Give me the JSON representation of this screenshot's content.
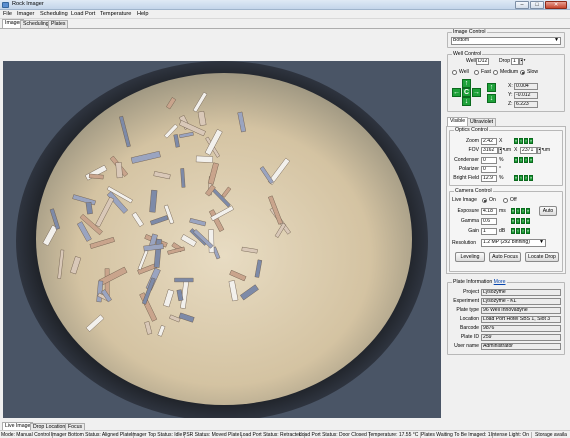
{
  "window": {
    "title": "Rock Imager",
    "minimize": "–",
    "maximize": "□",
    "close": "✕"
  },
  "menu": [
    "File",
    "Imager",
    "Scheduling",
    "Load Port",
    "Temperature",
    "Help"
  ],
  "tabs": [
    "Imager",
    "Scheduling",
    "Plates"
  ],
  "image_control": {
    "label": "Image Control",
    "value": "Bottom"
  },
  "well_control": {
    "label": "Well Control",
    "well_label": "Well",
    "well": "D12",
    "drop_label": "Drop",
    "drop": "1",
    "speeds": [
      "Well",
      "Fast",
      "Medium",
      "Slow"
    ],
    "selected_speed": "Slow",
    "x_label": "X:",
    "x": "0.004",
    "y_label": "Y:",
    "y": "-0.012",
    "z_label": "Z:",
    "z": "6.223",
    "center_label": "C"
  },
  "light_tabs": [
    "Visible",
    "Ultraviolet"
  ],
  "optics": {
    "label": "Optics Control",
    "zoom_label": "Zoom",
    "zoom": "2.42",
    "zoom_unit": "X",
    "fov_label": "FOV",
    "fov_w": "3162",
    "fov_h": "2371",
    "fov_unit": "um",
    "condenser_label": "Condenser",
    "condenser": "0",
    "pct": "%",
    "polarizer_label": "Polarizer",
    "polarizer": "0",
    "degree": "°",
    "bright_label": "Bright Field",
    "bright": "12.9"
  },
  "camera": {
    "label": "Camera Control",
    "live_label": "Live Image",
    "on": "On",
    "off": "Off",
    "exposure_label": "Exposure",
    "exposure": "4.18",
    "exposure_unit": "ms",
    "auto": "Auto",
    "gamma_label": "Gamma",
    "gamma": "0.6",
    "gain_label": "Gain",
    "gain": "1",
    "gain_unit": "dB",
    "resolution_label": "Resolution",
    "resolution": "1.2 MP (2x2 binning)",
    "leveling": "Leveling",
    "autofocus": "Auto Focus",
    "locate": "Locate Drop"
  },
  "plate": {
    "label": "Plate Information",
    "more": "More",
    "rows": [
      {
        "k": "Project",
        "v": "Lysozyme"
      },
      {
        "k": "Experiment",
        "v": "Lysozyme - KL"
      },
      {
        "k": "Plate type",
        "v": "96 Well Innovadyne"
      },
      {
        "k": "Location",
        "v": "Load Port Hotel SBS 1, Slot 3"
      },
      {
        "k": "Barcode",
        "v": "9876"
      },
      {
        "k": "Plate ID",
        "v": "259"
      },
      {
        "k": "User name",
        "v": "Administrator"
      }
    ]
  },
  "bottom_tabs": [
    "Live Image",
    "Drop Location",
    "Focus"
  ],
  "status": [
    "Mode: Manual Control",
    "Imager Bottom Status: Aligned Plate",
    "Imager Top Status: Idle",
    "PSR Status: Moved Plate",
    "Load Port Status: Retracted",
    "Load Port Status: Door Closed",
    "Temperature: 17.55 °C",
    "Plates Waiting To Be Imaged: 1",
    "Intense Light: On",
    "Storage availa"
  ],
  "crystal_colors": [
    "#f2f0ec",
    "#d9c8b8",
    "#7d8aa8",
    "#c9a48c",
    "#9aa4c0"
  ]
}
